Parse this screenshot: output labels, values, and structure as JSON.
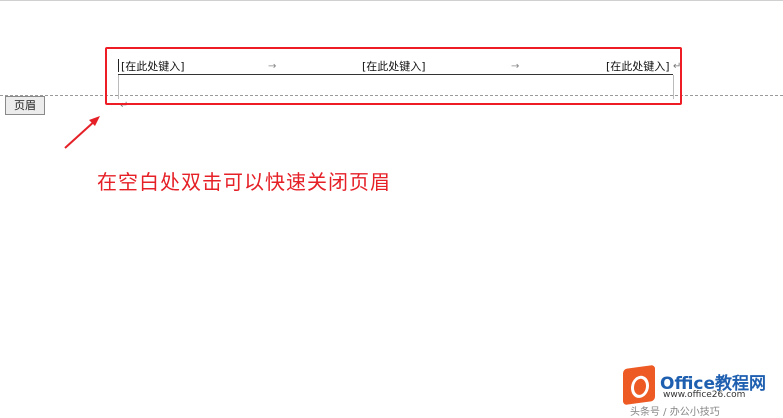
{
  "header": {
    "tag_label": "页眉",
    "placeholder_left": "[在此处键入]",
    "placeholder_center": "[在此处键入]",
    "placeholder_right": "[在此处键入]",
    "tab_arrow_glyph": "→",
    "para_mark_glyph": "↵"
  },
  "annotation": {
    "text": "在空白处双击可以快速关闭页眉",
    "color": "#e52027"
  },
  "highlight": {
    "color": "#ee1c25"
  },
  "watermark": {
    "brand": "Office教程网",
    "url": "www.office26.com",
    "footer": "头条号 / 办公小技巧"
  }
}
